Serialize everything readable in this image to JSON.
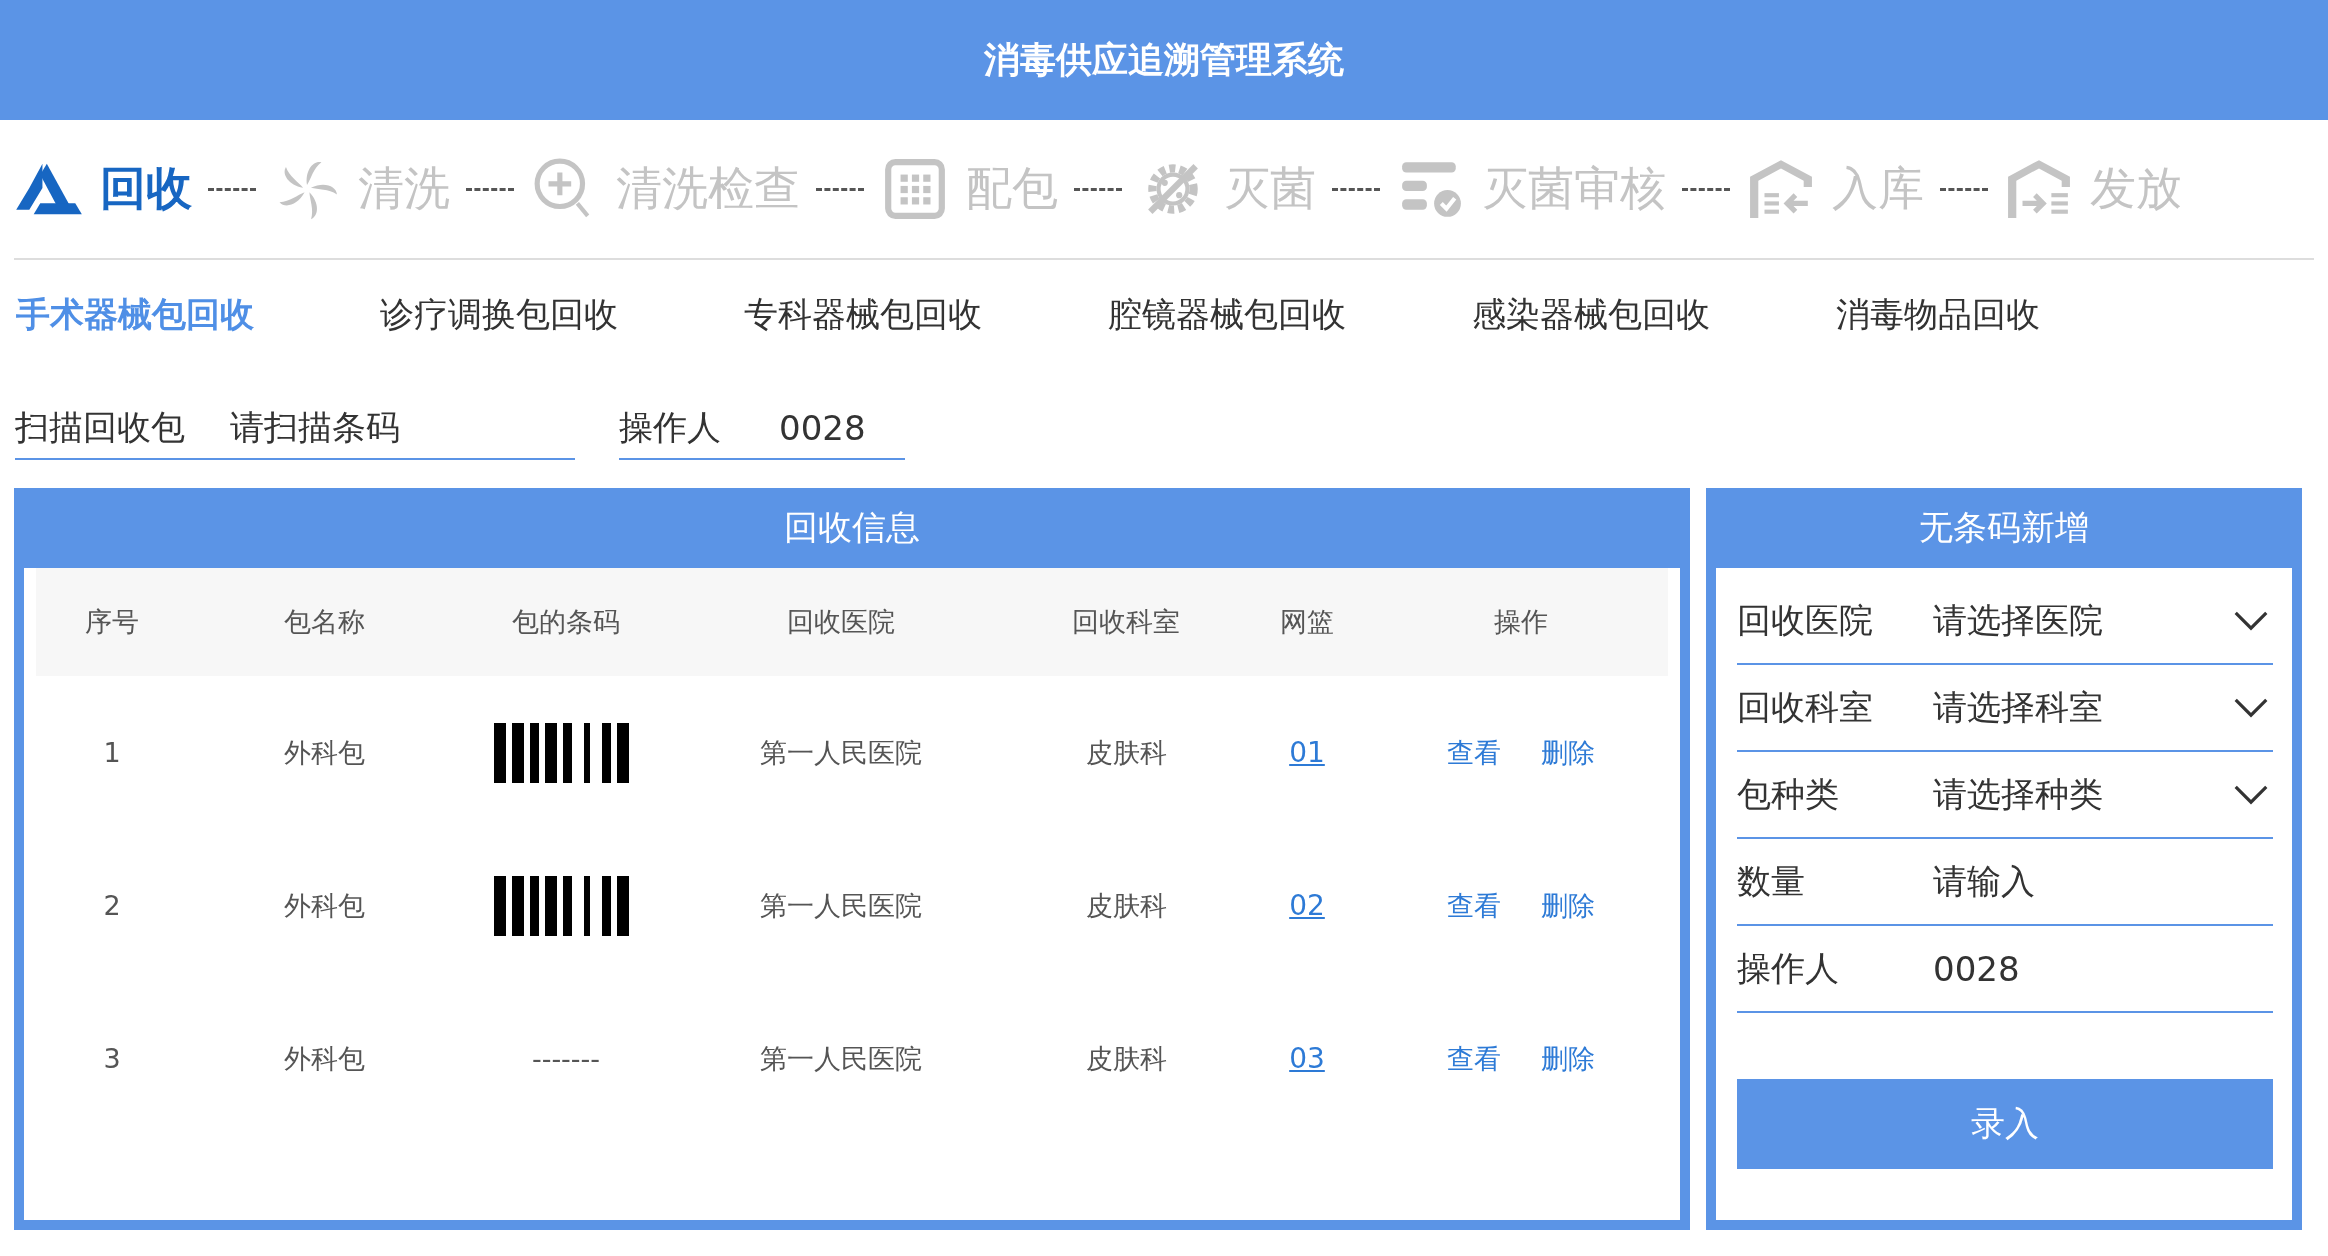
{
  "header": {
    "title": "消毒供应追溯管理系统"
  },
  "steps": [
    {
      "label": "回收",
      "selected": true
    },
    {
      "label": "清洗",
      "selected": false
    },
    {
      "label": "清洗检查",
      "selected": false
    },
    {
      "label": "配包",
      "selected": false
    },
    {
      "label": "灭菌",
      "selected": false
    },
    {
      "label": "灭菌审核",
      "selected": false
    },
    {
      "label": "入库",
      "selected": false
    },
    {
      "label": "发放",
      "selected": false
    }
  ],
  "tabs": [
    {
      "label": "手术器械包回收",
      "selected": true
    },
    {
      "label": "诊疗调换包回收",
      "selected": false
    },
    {
      "label": "专科器械包回收",
      "selected": false
    },
    {
      "label": "腔镜器械包回收",
      "selected": false
    },
    {
      "label": "感染器械包回收",
      "selected": false
    },
    {
      "label": "消毒物品回收",
      "selected": false
    }
  ],
  "scan": {
    "label": "扫描回收包",
    "placeholder": "请扫描条码"
  },
  "operator": {
    "label": "操作人",
    "value": "0028"
  },
  "recovery_panel": {
    "title": "回收信息",
    "table": {
      "columns": [
        "序号",
        "包名称",
        "包的条码",
        "回收医院",
        "回收科室",
        "网篮",
        "操作"
      ],
      "rows": [
        {
          "no": "1",
          "name": "外科包",
          "kind": "barcode",
          "hospital": "第一人民医院",
          "department": "皮肤科",
          "basket": "01",
          "actions": [
            "查看",
            "删除"
          ]
        },
        {
          "no": "2",
          "name": "外科包",
          "kind": "barcode",
          "hospital": "第一人民医院",
          "department": "皮肤科",
          "basket": "02",
          "actions": [
            "查看",
            "删除"
          ]
        },
        {
          "no": "3",
          "name": "外科包",
          "kind": "text",
          "code": "-------",
          "hospital": "第一人民医院",
          "department": "皮肤科",
          "basket": "03",
          "actions": [
            "查看",
            "删除"
          ]
        }
      ]
    }
  },
  "add_panel": {
    "title": "无条码新增",
    "fields": [
      {
        "kind": "select",
        "label": "回收医院",
        "placeholder": "请选择医院"
      },
      {
        "kind": "select",
        "label": "回收科室",
        "placeholder": "请选择科室"
      },
      {
        "kind": "select",
        "label": "包种类",
        "placeholder": "请选择种类"
      },
      {
        "kind": "input",
        "label": "数量",
        "placeholder": "请输入"
      },
      {
        "kind": "input",
        "label": "操作人",
        "value": "0028"
      }
    ],
    "button": "录入"
  }
}
